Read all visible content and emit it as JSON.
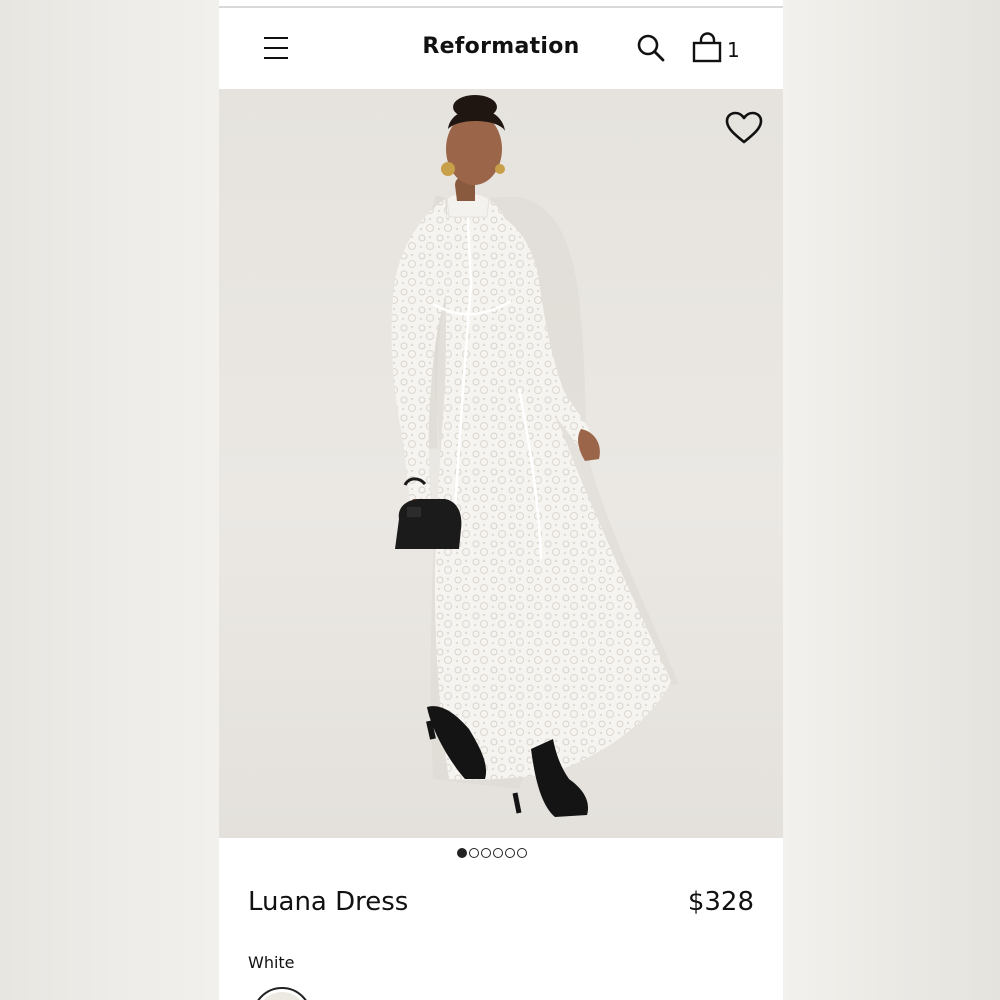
{
  "header": {
    "brand": "Reformation",
    "cart_count": "1",
    "icons": {
      "menu": "hamburger-menu-icon",
      "search": "search-icon",
      "cart": "shopping-bag-icon"
    }
  },
  "gallery": {
    "image_alt": "Model wearing the Luana Dress in white lace with a black handbag and black boots",
    "favorite_icon": "heart-outline-icon",
    "total_images": 6,
    "active_index": 0
  },
  "product": {
    "name": "Luana Dress",
    "price": "$328",
    "color_name": "White"
  },
  "colors": {
    "accent": "#111111",
    "background": "#ffffff",
    "image_bg": "#e8e5e0",
    "outer_bg": "#f2f0ec"
  }
}
